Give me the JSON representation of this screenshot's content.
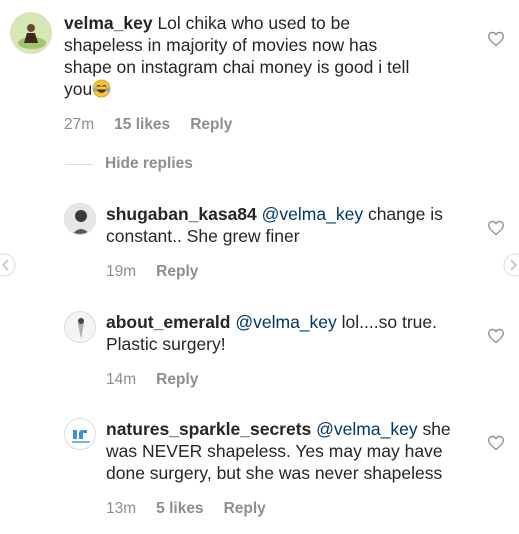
{
  "comments": [
    {
      "username": "velma_key",
      "mention": "",
      "text": "Lol chika who used to be shapeless in majority of movies now has shape on instagram chai money is good i tell you",
      "emoji": "😂",
      "time": "27m",
      "likes": "15 likes",
      "reply": "Reply"
    },
    {
      "username": "shugaban_kasa84",
      "mention": "@velma_key",
      "text": "change is constant.. She grew finer",
      "time": "19m",
      "likes": "",
      "reply": "Reply"
    },
    {
      "username": "about_emerald",
      "mention": "@velma_key",
      "text": "lol....so true. Plastic surgery!",
      "time": "14m",
      "likes": "",
      "reply": "Reply"
    },
    {
      "username": "natures_sparkle_secrets",
      "mention": "@velma_key",
      "text": "she was NEVER shapeless. Yes may may have done surgery, but she was never shapeless",
      "time": "13m",
      "likes": "5 likes",
      "reply": "Reply"
    }
  ],
  "hide_replies": "Hide replies",
  "colors": {
    "text": "#262626",
    "meta": "#8e8e8e",
    "mention": "#00376b",
    "divider": "#dbdbdb"
  },
  "icons": {
    "like": "heart-outline-icon",
    "nav_left": "chevron-left-icon",
    "nav_right": "chevron-right-icon"
  }
}
